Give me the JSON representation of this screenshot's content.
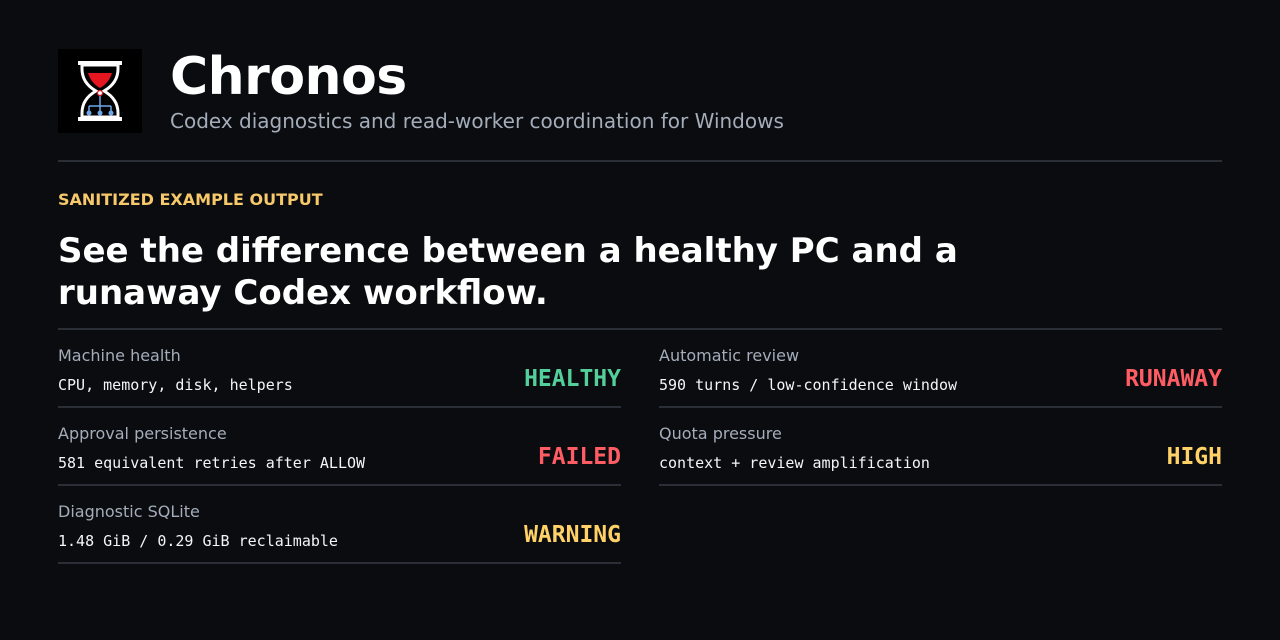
{
  "app": {
    "title": "Chronos",
    "subtitle": "Codex diagnostics and read-worker coordination for Windows",
    "logo_icon": "hourglass-network-icon"
  },
  "section": {
    "eyebrow": "SANITIZED EXAMPLE OUTPUT",
    "headline": "See the difference between a healthy PC and a runaway Codex workflow."
  },
  "colors": {
    "background": "#0a0c10",
    "healthy": "#52cf9b",
    "failed": "#ff5c63",
    "warning": "#ffd166",
    "eyebrow": "#f7c96b",
    "muted": "#a4adb9"
  },
  "left_rows": [
    {
      "title": "Machine health",
      "detail": "CPU, memory, disk, helpers",
      "status": "HEALTHY",
      "status_color": "#52cf9b"
    },
    {
      "title": "Approval persistence",
      "detail": "581 equivalent retries after ALLOW",
      "status": "FAILED",
      "status_color": "#ff5c63"
    },
    {
      "title": "Diagnostic SQLite",
      "detail": "1.48 GiB / 0.29 GiB reclaimable",
      "status": "WARNING",
      "status_color": "#ffd166"
    }
  ],
  "right_rows": [
    {
      "title": "Automatic review",
      "detail": "590 turns / low-confidence window",
      "status": "RUNAWAY",
      "status_color": "#ff5c63"
    },
    {
      "title": "Quota pressure",
      "detail": "context + review amplification",
      "status": "HIGH",
      "status_color": "#ffd166"
    }
  ]
}
